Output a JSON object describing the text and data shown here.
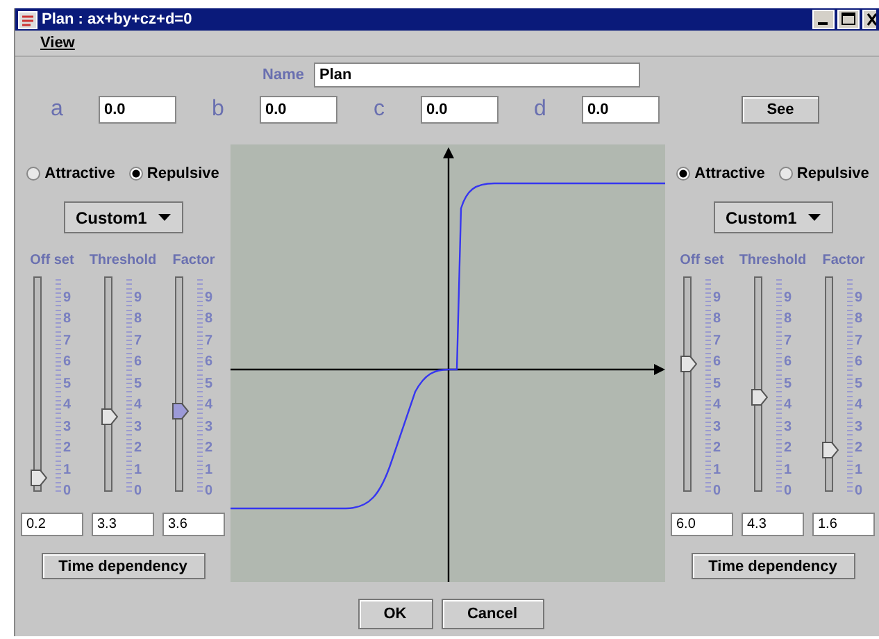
{
  "window": {
    "title": "Plan : ax+by+cz+d=0"
  },
  "menu": [
    {
      "label": "View"
    }
  ],
  "name_field": {
    "label": "Name",
    "value": "Plan"
  },
  "coefficients": [
    {
      "label": "a",
      "value": "0.0"
    },
    {
      "label": "b",
      "value": "0.0"
    },
    {
      "label": "c",
      "value": "0.0"
    },
    {
      "label": "d",
      "value": "0.0"
    }
  ],
  "see_button": "See",
  "panels": [
    {
      "modes": [
        {
          "label": "Attractive",
          "selected": false
        },
        {
          "label": "Repulsive",
          "selected": true
        }
      ],
      "preset": "Custom1",
      "sliders": [
        {
          "label": "Off set",
          "level": 0.02,
          "focused": false,
          "value": "0.2",
          "ticks": [
            "9",
            "8",
            "7",
            "6",
            "5",
            "4",
            "3",
            "2",
            "1",
            "0"
          ]
        },
        {
          "label": "Threshold",
          "level": 0.33,
          "focused": false,
          "value": "3.3",
          "ticks": [
            "9",
            "8",
            "7",
            "6",
            "5",
            "4",
            "3",
            "2",
            "1",
            "0"
          ]
        },
        {
          "label": "Factor",
          "level": 0.36,
          "focused": true,
          "value": "3.6",
          "ticks": [
            "9",
            "8",
            "7",
            "6",
            "5",
            "4",
            "3",
            "2",
            "1",
            "0"
          ]
        }
      ],
      "button": "Time dependency"
    },
    {
      "modes": [
        {
          "label": "Attractive",
          "selected": true
        },
        {
          "label": "Repulsive",
          "selected": false
        }
      ],
      "preset": "Custom1",
      "sliders": [
        {
          "label": "Off set",
          "level": 0.6,
          "focused": false,
          "value": "6.0",
          "ticks": [
            "9",
            "8",
            "7",
            "6",
            "5",
            "4",
            "3",
            "2",
            "1",
            "0"
          ]
        },
        {
          "label": "Threshold",
          "level": 0.43,
          "focused": false,
          "value": "4.3",
          "ticks": [
            "9",
            "8",
            "7",
            "6",
            "5",
            "4",
            "3",
            "2",
            "1",
            "0"
          ]
        },
        {
          "label": "Factor",
          "level": 0.16,
          "focused": false,
          "value": "1.6",
          "ticks": [
            "9",
            "8",
            "7",
            "6",
            "5",
            "4",
            "3",
            "2",
            "1",
            "0"
          ]
        }
      ],
      "button": "Time dependency"
    }
  ],
  "buttons": [
    "OK",
    "Cancel"
  ]
}
